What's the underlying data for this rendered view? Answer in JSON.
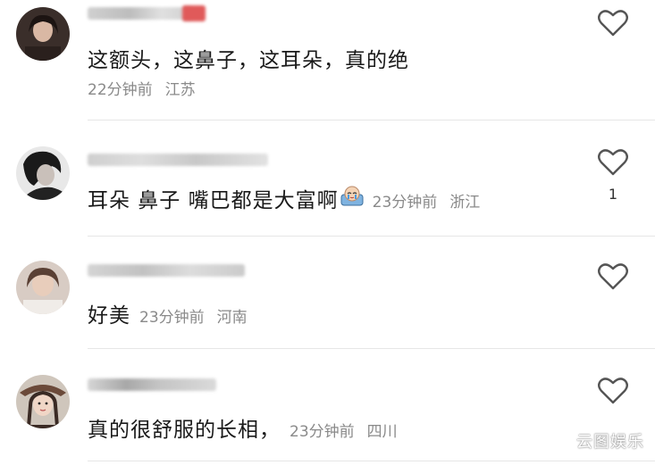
{
  "comments": [
    {
      "text": "这额头，这鼻子，这耳朵，真的绝",
      "time": "22分钟前",
      "location": "江苏",
      "likes": ""
    },
    {
      "text": "耳朵 鼻子 嘴巴都是大富啊",
      "emoji": "crying-emoji",
      "time": "23分钟前",
      "location": "浙江",
      "likes": "1"
    },
    {
      "text": "好美",
      "time": "23分钟前",
      "location": "河南",
      "likes": ""
    },
    {
      "text": "真的很舒服的长相，",
      "time": "23分钟前",
      "location": "四川",
      "likes": ""
    }
  ],
  "icons": {
    "like": "heart-outline-icon"
  },
  "watermark": "云图娱乐"
}
